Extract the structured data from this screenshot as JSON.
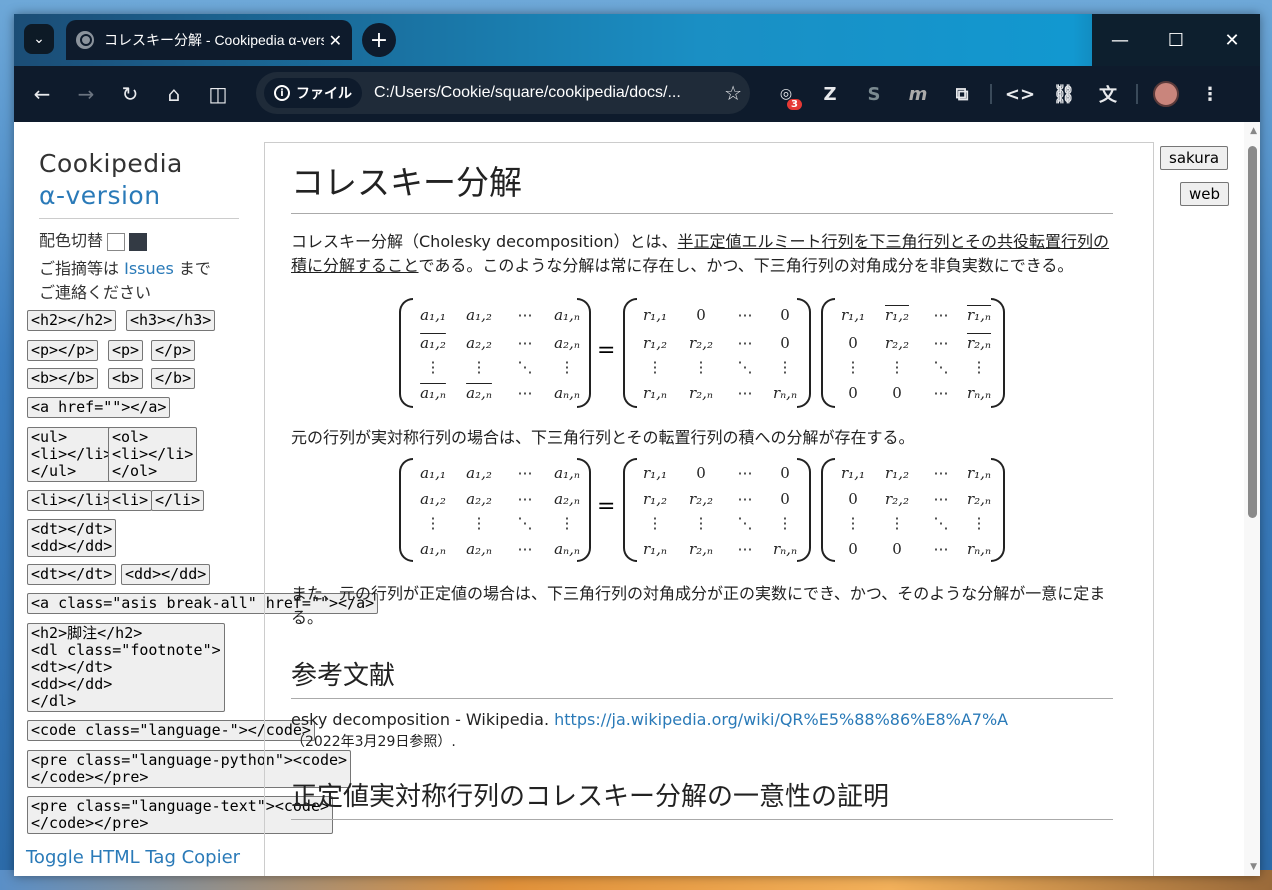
{
  "browser": {
    "tab_title": "コレスキー分解 - Cookipedia α-version",
    "file_chip": "ファイル",
    "url": "C:/Users/Cookie/square/cookipedia/docs/...",
    "ext_badge": "3"
  },
  "sidebar": {
    "brand_line1": "Cookipedia",
    "brand_line2": "α-version",
    "color_switch": "配色切替",
    "feedback_prefix": "ご指摘等は",
    "feedback_link": "Issues",
    "feedback_suffix": "まで",
    "feedback_line2": "ご連絡ください",
    "toggle_link": "Toggle HTML Tag Copier"
  },
  "tag_buttons": {
    "h2": "<h2></h2>",
    "h3": "<h3></h3>",
    "p_pair": "<p></p>",
    "p_open": "<p>",
    "p_close": "</p>",
    "b_pair": "<b></b>",
    "b_open": "<b>",
    "b_close": "</b>",
    "a_href": "<a href=\"\"></a>",
    "ul": "<ul>\n<li></li>\n</ul>",
    "ol": "<ol>\n<li></li>\n</ol>",
    "li_pair": "<li></li>",
    "li_open": "<li>",
    "li_close": "</li>",
    "dt_dd": "<dt></dt>\n<dd></dd>",
    "dt": "<dt></dt>",
    "dd": "<dd></dd>",
    "a_asis": "<a class=\"asis break-all\" href=\"\"></a>",
    "footnote": "<h2>脚注</h2>\n<dl class=\"footnote\">\n<dt></dt>\n<dd></dd>\n</dl>",
    "code_lang": "<code class=\"language-\"></code>",
    "pre_python": "<pre class=\"language-python\"><code>\n</code></pre>",
    "pre_text": "<pre class=\"language-text\"><code>\n</code></pre>"
  },
  "article": {
    "title": "コレスキー分解",
    "intro_prefix": "コレスキー分解（Cholesky decomposition）とは、",
    "intro_link": "半正定値エルミート行列を下三角行列とその共役転置行列の積に分解すること",
    "intro_suffix": "である。このような分解は常に存在し、かつ、下三角行列の対角成分を非負実数にできる。",
    "para_sym": "元の行列が実対称行列の場合は、下三角行列とその転置行列の積への分解が存在する。",
    "para_posdef": "また、元の行列が正定値の場合は、下三角行列の対角成分が正の実数にでき、かつ、そのような分解が一意に定まる。",
    "h2_refs": "参考文献",
    "ref_text": "esky decomposition - Wikipedia.",
    "ref_url": "https://ja.wikipedia.org/wiki/QR%E5%88%86%E8%A7%A",
    "ref_date": "（2022年3月29日参照）.",
    "h2_proof": "正定値実対称行列のコレスキー分解の一意性の証明"
  },
  "right_buttons": {
    "sakura": "sakura",
    "web": "web"
  }
}
